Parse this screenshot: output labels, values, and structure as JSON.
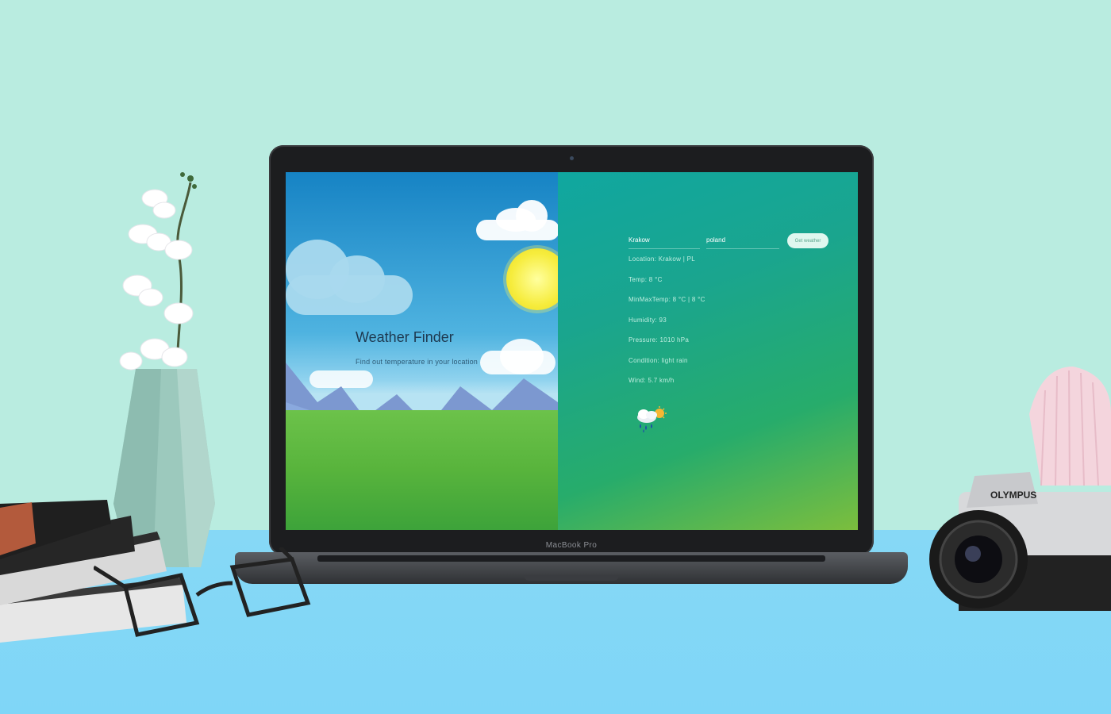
{
  "device": {
    "brand_label": "MacBook Pro"
  },
  "hero": {
    "title": "Weather Finder",
    "subtitle": "Find out temperature in your location"
  },
  "form": {
    "city_value": "Krakow",
    "country_value": "poland",
    "button_label": "Get weather"
  },
  "results": {
    "location": "Location: Krakow | PL",
    "temp": "Temp: 8 °C",
    "minmax": "MinMaxTemp: 8 °C | 8 °C",
    "humidity": "Humidity: 93",
    "pressure": "Pressure: 1010 hPa",
    "condition": "Condition: light rain",
    "wind": "Wind: 5.7 km/h"
  },
  "weather_icon": "rain-sun-icon",
  "camera_brand": "OLYMPUS",
  "colors": {
    "background": "#b9ece0",
    "desk": "#82d7f6",
    "panel_gradient_start": "#10a7a0",
    "panel_gradient_end": "#7cbe3d",
    "button_bg": "#dff7ef"
  }
}
